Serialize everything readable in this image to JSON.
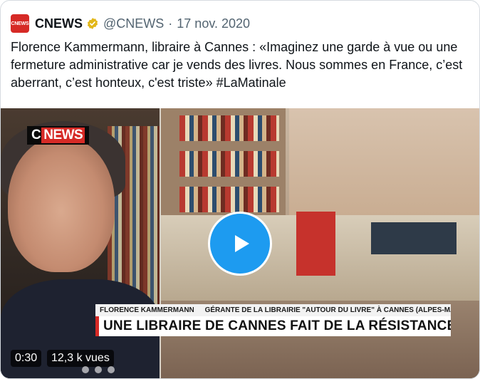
{
  "tweet": {
    "avatar_text": "CNEWS",
    "author_name": "CNEWS",
    "handle": "@CNEWS",
    "separator": "·",
    "date": "17 nov. 2020",
    "text": "Florence Kammermann, libraire à Cannes : «Imaginez une garde à vue ou une fermeture administrative car je vends des livres. Nous sommes en France, c’est aberrant, c’est honteux, c'est triste» #LaMatinale"
  },
  "video": {
    "logo_c": "C",
    "logo_news": "NEWS",
    "lower_third_name": "FLORENCE KAMMERMANN",
    "lower_third_role": "GÉRANTE DE LA LIBRAIRIE \"AUTOUR DU LIVRE\" À CANNES (ALPES-MARITIMES)",
    "headline": "UNE LIBRAIRE DE CANNES FAIT DE LA RÉSISTANCE",
    "duration": "0:30",
    "views": "12,3 k vues"
  },
  "colors": {
    "accent": "#1d9bf0",
    "brand_red": "#d62a26",
    "verified_gold": "#e2b719"
  },
  "icons": {
    "verified": "verified-badge-icon",
    "play": "play-icon"
  }
}
